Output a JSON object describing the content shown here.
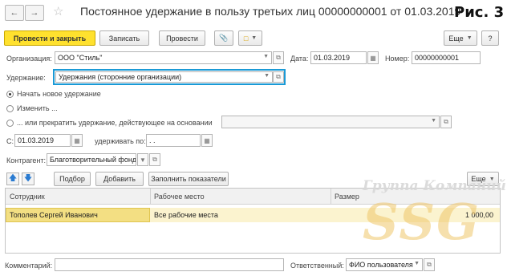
{
  "window": {
    "title": "Постоянное удержание в пользу третьих лиц 00000000001 от 01.03.2019",
    "caption": "Рис. 3"
  },
  "toolbar": {
    "post_close": "Провести и закрыть",
    "save": "Записать",
    "post": "Провести",
    "more": "Еще",
    "help": "?"
  },
  "fields": {
    "org_label": "Организация:",
    "org_value": "ООО \"Стиль\"",
    "date_label": "Дата:",
    "date_value": "01.03.2019",
    "number_label": "Номер:",
    "number_value": "00000000001",
    "deduction_label": "Удержание:",
    "deduction_value": "Удержания (сторонние организации)",
    "from_label": "С:",
    "from_value": "01.03.2019",
    "until_label": "удерживать по:",
    "until_value": ". .",
    "counterparty_label": "Контрагент:",
    "counterparty_value": "Благотворительный фонд",
    "comment_label": "Комментарий:",
    "comment_value": "",
    "responsible_label": "Ответственный:",
    "responsible_value": "ФИО пользователя"
  },
  "radios": {
    "new": "Начать новое удержание",
    "change": "Изменить ...",
    "stop": "... или прекратить удержание, действующее на основании"
  },
  "table_toolbar": {
    "pick": "Подбор",
    "add": "Добавить",
    "fill": "Заполнить показатели",
    "more": "Еще"
  },
  "table": {
    "columns": [
      "Сотрудник",
      "Рабочее место",
      "Размер"
    ],
    "rows": [
      [
        "Тополев Сергей Иванович",
        "Все рабочие места",
        "1 000,00"
      ]
    ]
  },
  "watermark": {
    "line1": "Группа Компаний",
    "line2": "SSG"
  }
}
